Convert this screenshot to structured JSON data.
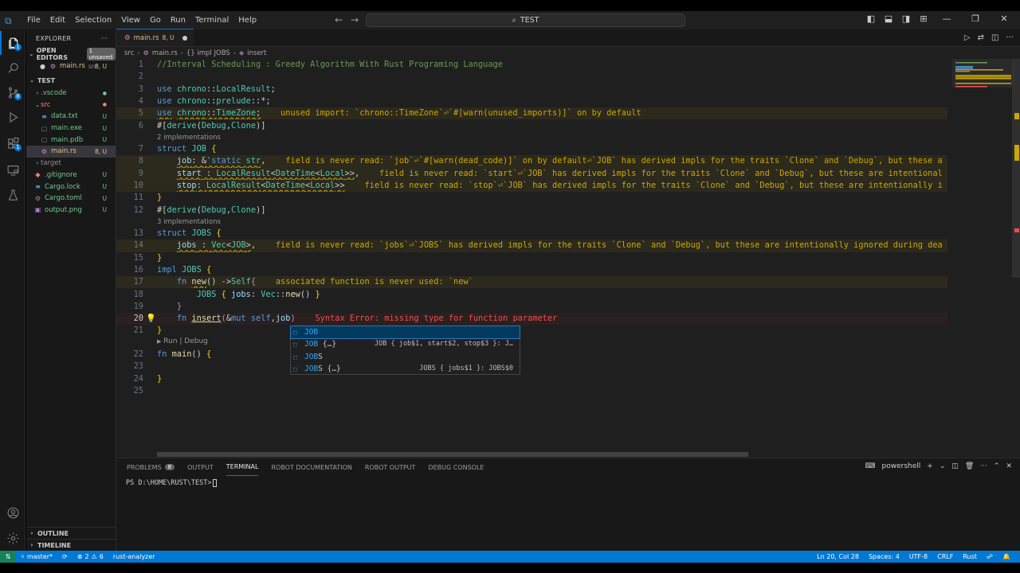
{
  "titlebar": {
    "menu": [
      "File",
      "Edit",
      "Selection",
      "View",
      "Go",
      "Run",
      "Terminal",
      "Help"
    ],
    "search_text": "TEST"
  },
  "sidebar": {
    "title": "EXPLORER",
    "open_editors": {
      "label": "OPEN EDITORS",
      "badge": "1 unsaved"
    },
    "open_file": {
      "name": "main.rs",
      "path": "src",
      "status": "8, U"
    },
    "project": "TEST",
    "tree": [
      {
        "name": ".vscode",
        "status": "●",
        "kind": "folder"
      },
      {
        "name": "src",
        "status": "●",
        "kind": "folder"
      },
      {
        "name": "data.txt",
        "status": "U",
        "kind": "txt"
      },
      {
        "name": "main.exe",
        "status": "U",
        "kind": "exe"
      },
      {
        "name": "main.pdb",
        "status": "U",
        "kind": "pdb"
      },
      {
        "name": "main.rs",
        "status": "8, U",
        "kind": "rs"
      },
      {
        "name": "target",
        "status": "",
        "kind": "folder"
      },
      {
        "name": ".gitignore",
        "status": "U",
        "kind": "git"
      },
      {
        "name": "Cargo.lock",
        "status": "U",
        "kind": "lock"
      },
      {
        "name": "Cargo.toml",
        "status": "U",
        "kind": "toml"
      },
      {
        "name": "output.png",
        "status": "U",
        "kind": "png"
      }
    ],
    "outline": "OUTLINE",
    "timeline": "TIMELINE"
  },
  "editor": {
    "tab": {
      "name": "main.rs",
      "status": "8, U"
    },
    "breadcrumb": [
      "src",
      "main.rs",
      "{} impl JOBS",
      "insert"
    ],
    "codelens_2": "2 implementations",
    "codelens_3": "3 implementations",
    "run_debug": "Run | Debug",
    "diag": {
      "l5": "unused import: `chrono::TimeZone`⏎`#[warn(unused_imports)]` on by default",
      "l8": "field is never read: `job`⏎`#[warn(dead_code)]` on by default⏎`JOB` has derived impls for the traits `Clone` and `Debug`, but these a",
      "l9": "field is never read: `start`⏎`JOB` has derived impls for the traits `Clone` and `Debug`, but these are intentional",
      "l10": "field is never read: `stop`⏎`JOB` has derived impls for the traits `Clone` and `Debug`, but these are intentionally i",
      "l14": "field is never read: `jobs`⏎`JOBS` has derived impls for the traits `Clone` and `Debug`, but these are intentionally ignored during dea",
      "l17": "associated function is never used: `new`",
      "l20": "Syntax Error: missing type for function parameter"
    },
    "suggestions": [
      {
        "label": "JOB",
        "detail": ""
      },
      {
        "label": "JOB {…}",
        "detail": "JOB { job$1, start$2, stop$3 }: J…"
      },
      {
        "label": "JOBS",
        "detail": ""
      },
      {
        "label": "JOBS {…}",
        "detail": "JOBS { jobs$1 }: JOBS$0"
      }
    ]
  },
  "panel": {
    "tabs": [
      "PROBLEMS",
      "OUTPUT",
      "TERMINAL",
      "ROBOT DOCUMENTATION",
      "ROBOT OUTPUT",
      "DEBUG CONSOLE"
    ],
    "problems_count": "8",
    "shell": "powershell",
    "prompt": "PS D:\\HOME\\RUST\\TEST>"
  },
  "statusbar": {
    "branch": "master*",
    "errors": "2",
    "warnings": "6",
    "analyzer": "rust-analyzer",
    "position": "Ln 20, Col 28",
    "spaces": "Spaces: 4",
    "encoding": "UTF-8",
    "eol": "CRLF",
    "language": "Rust"
  },
  "colors": {
    "accent": "#0078d4",
    "warning": "#cca700",
    "error": "#f14c4c",
    "untracked": "#73c991"
  },
  "icons": [
    "explorer-icon",
    "search-icon",
    "source-control-icon",
    "run-debug-icon",
    "extensions-icon",
    "remote-explorer-icon",
    "testing-icon",
    "account-icon",
    "settings-gear-icon"
  ]
}
